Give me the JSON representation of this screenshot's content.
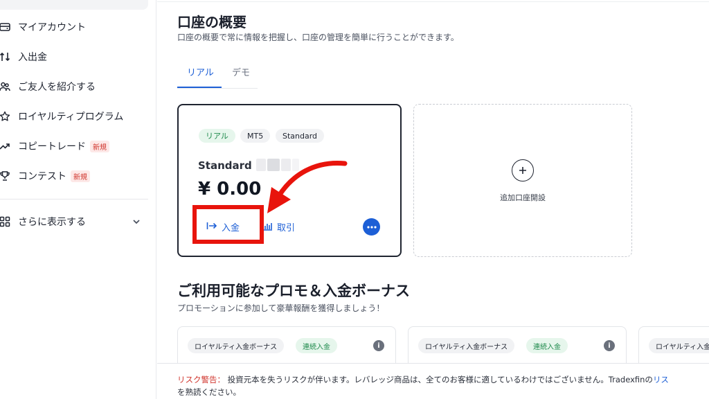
{
  "sidebar": {
    "items": [
      {
        "label": "マイアカウント",
        "icon": "wallet-icon"
      },
      {
        "label": "入出金",
        "icon": "arrows-updown-icon"
      },
      {
        "label": "ご友人を紹介する",
        "icon": "users-icon"
      },
      {
        "label": "ロイヤルティプログラム",
        "icon": "star-icon"
      },
      {
        "label": "コピートレード",
        "icon": "trend-icon",
        "badge": "新規"
      },
      {
        "label": "コンテスト",
        "icon": "trophy-icon",
        "badge": "新規"
      }
    ],
    "more_label": "さらに表示する"
  },
  "main": {
    "title": "口座の概要",
    "subtitle": "口座の概要で常に情報を把握し、口座の管理を簡単に行うことができます。",
    "tabs": [
      {
        "label": "リアル",
        "active": true
      },
      {
        "label": "デモ",
        "active": false
      }
    ]
  },
  "account_card": {
    "tags": [
      "リアル",
      "MT5",
      "Standard"
    ],
    "name": "Standard",
    "balance": "¥ 0.00",
    "deposit_label": "入金",
    "withdraw_label": "取引"
  },
  "add_account": {
    "label": "追加口座開設"
  },
  "promo": {
    "title": "ご利用可能なプロモ＆入金ボーナス",
    "subtitle": "プロモーションに参加して豪華報酬を獲得しましょう！",
    "cards": [
      {
        "tag": "ロイヤルティ入金ボーナス",
        "status": "連続入金"
      },
      {
        "tag": "ロイヤルティ入金ボーナス",
        "status": "連続入金"
      },
      {
        "tag": "ロイヤルティ入金ボ"
      }
    ]
  },
  "risk": {
    "label": "リスク警告：",
    "text": " 投資元本を失うリスクが伴います。レバレッジ商品は、全てのお客様に適しているわけではございません。Tradexfinの",
    "link": "リス",
    "line2": "を熟読ください。"
  },
  "colors": {
    "accent": "#1d5fd6",
    "highlight": "#e8140c",
    "badge_text": "#d0342c",
    "real_tag_bg": "#e6f6ec"
  }
}
